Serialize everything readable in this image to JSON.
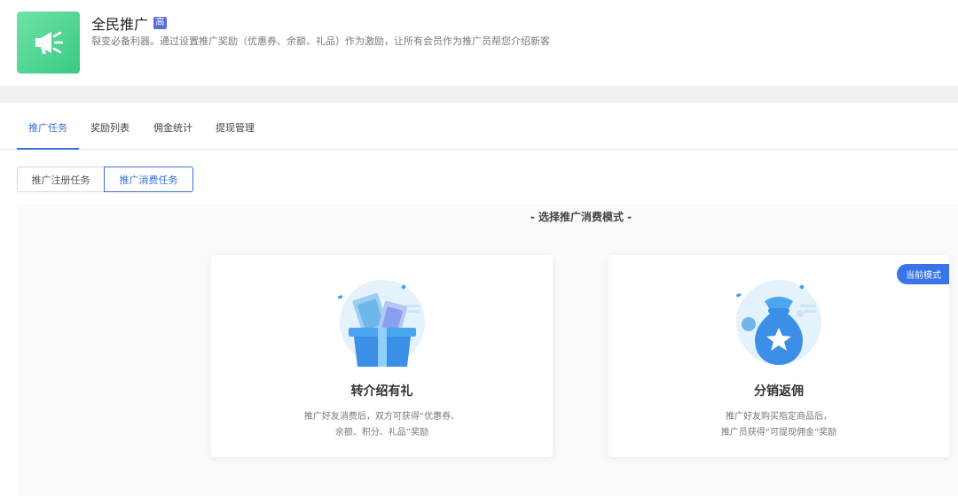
{
  "header": {
    "title": "全民推广",
    "badge": "高",
    "description": "裂变必备利器。通过设置推广奖励（优惠券、余额、礼品）作为激励，让所有会员作为推广员帮您介绍新客",
    "icon": "megaphone-icon"
  },
  "tabs": [
    {
      "label": "推广任务",
      "active": true
    },
    {
      "label": "奖励列表",
      "active": false
    },
    {
      "label": "佣金统计",
      "active": false
    },
    {
      "label": "提现管理",
      "active": false
    }
  ],
  "task_types": [
    {
      "label": "推广注册任务",
      "selected": false
    },
    {
      "label": "推广消费任务",
      "selected": true
    }
  ],
  "section_title": "- 选择推广消费模式 -",
  "modes": [
    {
      "title": "转介绍有礼",
      "desc_line1": "推广好友消费后，双方可获得“优惠券、",
      "desc_line2": "余额、积分、礼品”奖励",
      "icon": "gift-box-icon",
      "current": false
    },
    {
      "title": "分销返佣",
      "desc_line1": "推广好友购买指定商品后，",
      "desc_line2": "推广员获得“可提现佣金”奖励",
      "icon": "money-bag-icon",
      "current": true,
      "current_label": "当前模式"
    }
  ],
  "colors": {
    "accent": "#3a6fd8",
    "brand_green": "#39c982",
    "badge": "#5b6bd9"
  }
}
